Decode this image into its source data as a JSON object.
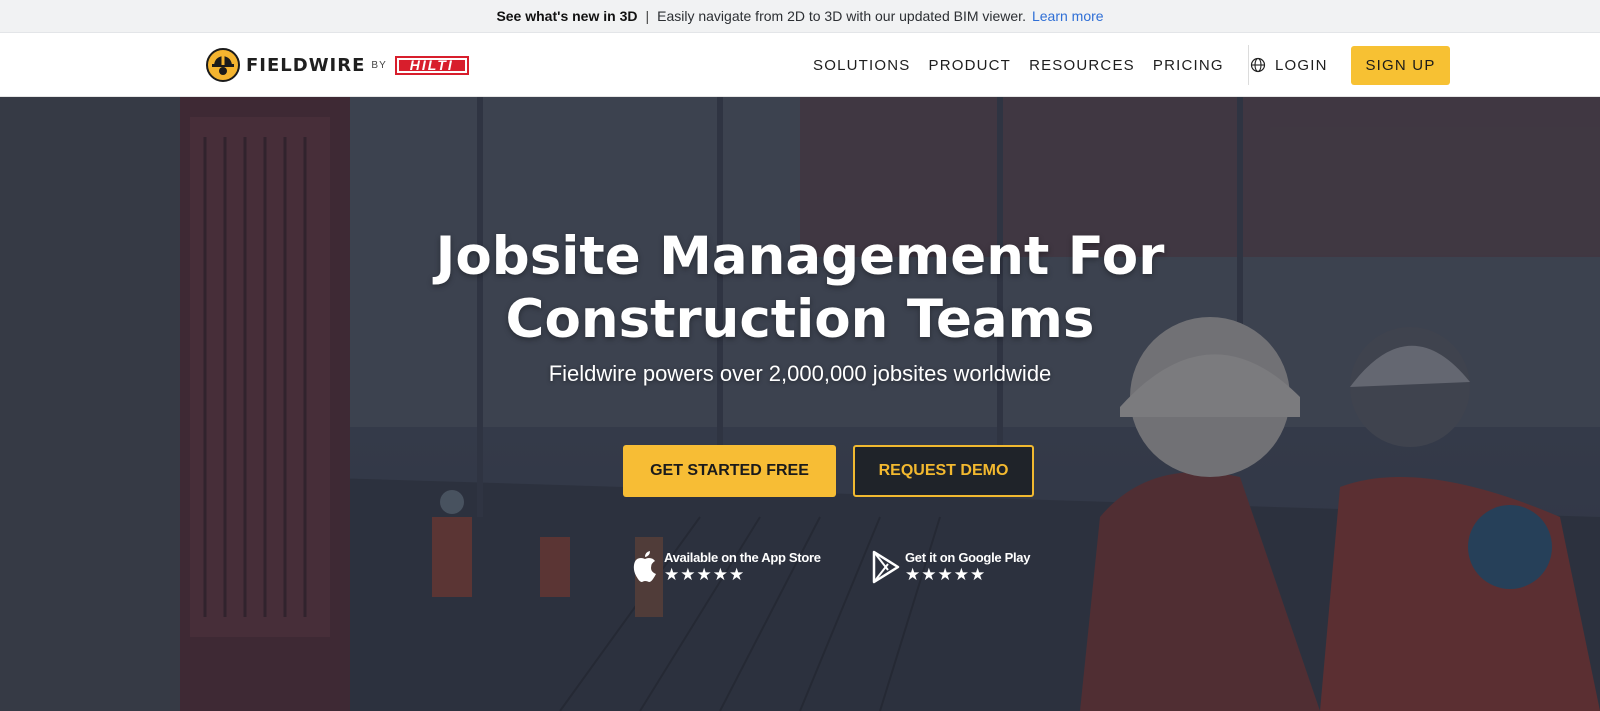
{
  "announcement": {
    "headline": "See what's new in 3D",
    "separator": "|",
    "text": "Easily navigate from 2D to 3D with our updated BIM viewer.",
    "link": "Learn more"
  },
  "header": {
    "brand": "FIELDWIRE",
    "by": "BY",
    "partner": "HILTI",
    "nav": [
      "SOLUTIONS",
      "PRODUCT",
      "RESOURCES",
      "PRICING"
    ],
    "login": "LOGIN",
    "signup": "SIGN UP"
  },
  "hero": {
    "title_line1": "Jobsite Management For",
    "title_line2": "Construction Teams",
    "subtitle": "Fieldwire powers over 2,000,000 jobsites worldwide",
    "cta_primary": "GET STARTED FREE",
    "cta_secondary": "REQUEST DEMO",
    "app_store": {
      "label": "Available on the App Store",
      "stars": "★★★★★",
      "rating": 5
    },
    "google_play": {
      "label": "Get it on Google Play",
      "stars": "★★★★★",
      "rating": 5
    }
  },
  "colors": {
    "accent_yellow": "#f7c133",
    "link_blue": "#2f6fd6",
    "hilti_red": "#d81e2c",
    "dark_button": "#1f2329"
  },
  "icons": [
    "fieldwire-hardhat-logo",
    "globe-icon",
    "apple-icon",
    "google-play-icon",
    "star-icon"
  ]
}
